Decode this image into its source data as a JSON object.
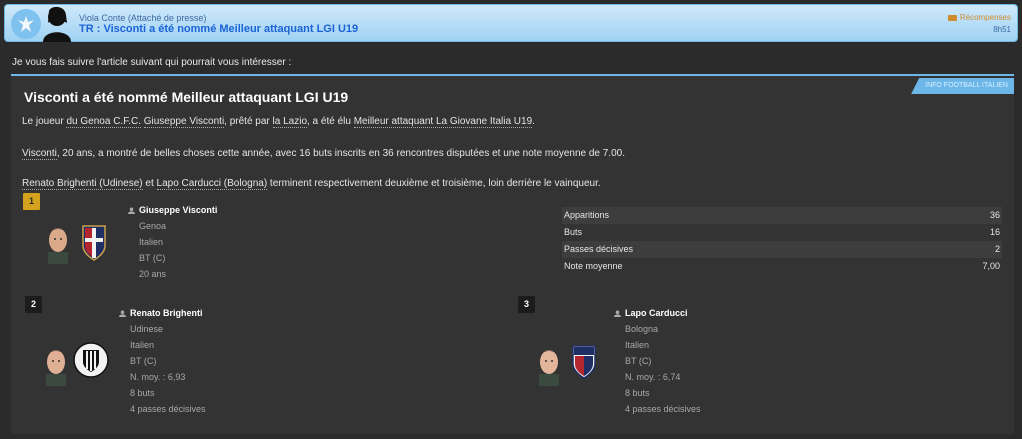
{
  "header": {
    "sender": "Viola Conte  (Attaché de presse)",
    "subject": "TR : Visconti a été nommé Meilleur attaquant LGI U19",
    "reward_label": "Récompenses",
    "time": "8h51",
    "accent_color": "#1b63d6"
  },
  "intro": "Je vous fais suivre l'article suivant qui pourrait vous intéresser :",
  "article": {
    "source_tag": "INFO FOOTBALL ITALIEN",
    "title": "Visconti a été nommé Meilleur attaquant LGI U19",
    "p1": {
      "a": "Le joueur ",
      "club": "du Genoa C.F.C.",
      "b": " ",
      "player": "Giuseppe Visconti",
      "c": ", prêté par ",
      "loan": "la Lazio",
      "d": ", a été élu ",
      "award": "Meilleur attaquant La Giovane Italia U19",
      "e": "."
    },
    "p2": {
      "player": "Visconti",
      "rest": ", 20 ans, a montré de belles choses cette année, avec 16 buts inscrits en 36 rencontres disputées et une note moyenne de 7.00."
    },
    "p3": {
      "second": "Renato Brighenti (Udinese)",
      "a": " et ",
      "third": "Lapo Carducci (Bologna)",
      "b": " terminent respectivement deuxième et troisième, loin derrière le vainqueur."
    }
  },
  "winner": {
    "rank": "1",
    "name": "Giuseppe Visconti",
    "club": "Genoa",
    "nationality": "Italien",
    "position": "BT (C)",
    "age": "20 ans",
    "stats": [
      {
        "label": "Apparitions",
        "value": "36"
      },
      {
        "label": "Buts",
        "value": "16"
      },
      {
        "label": "Passes décisives",
        "value": "2"
      },
      {
        "label": "Note moyenne",
        "value": "7,00"
      }
    ]
  },
  "second": {
    "rank": "2",
    "name": "Renato Brighenti",
    "club": "Udinese",
    "nationality": "Italien",
    "position": "BT (C)",
    "rating": "N. moy. : 6,93",
    "goals": "8 buts",
    "assists": "4 passes décisives"
  },
  "third": {
    "rank": "3",
    "name": "Lapo Carducci",
    "club": "Bologna",
    "nationality": "Italien",
    "position": "BT (C)",
    "rating": "N. moy. : 6,74",
    "goals": "8 buts",
    "assists": "4 passes décisives"
  }
}
